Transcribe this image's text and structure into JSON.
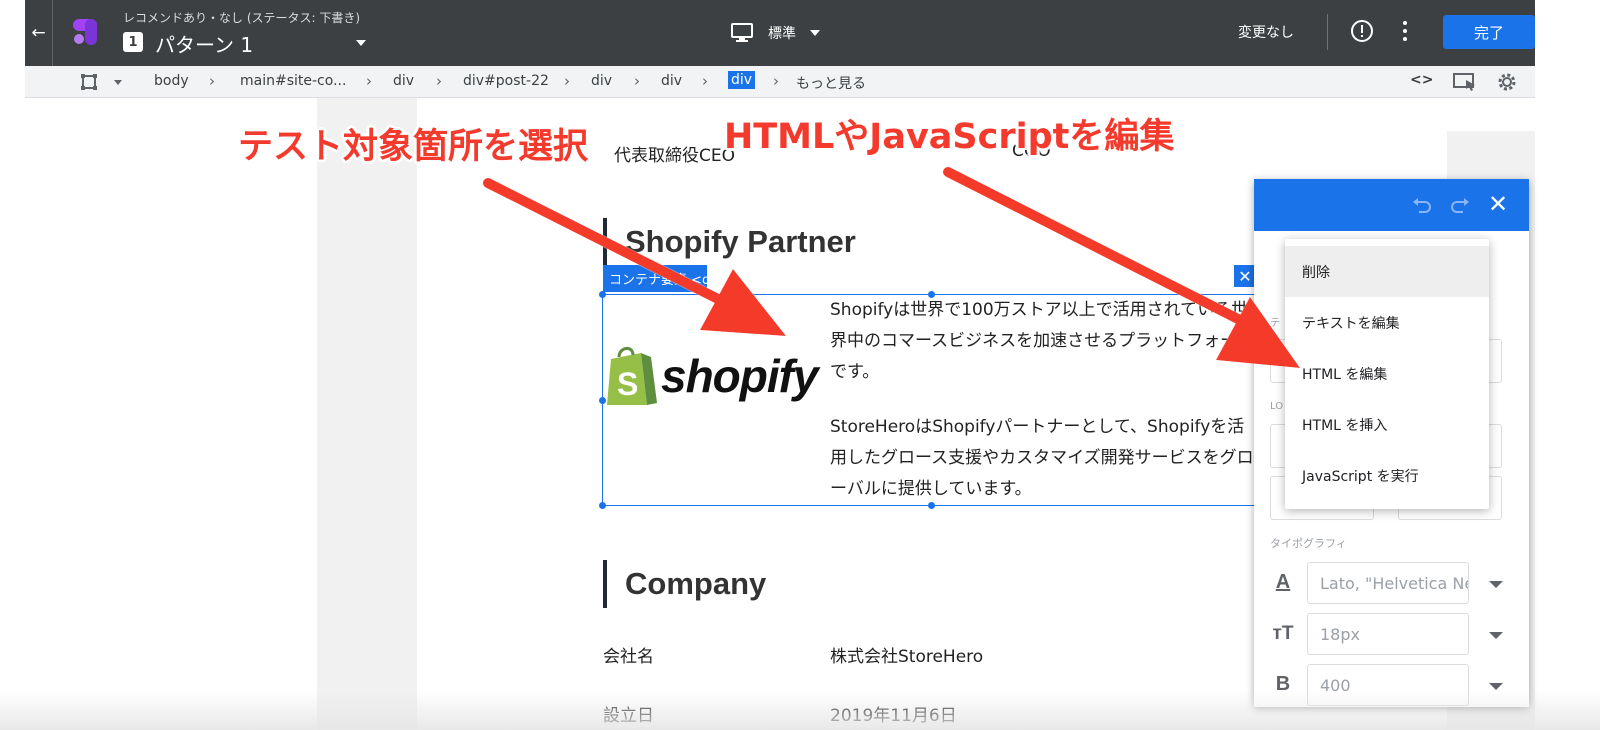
{
  "topbar": {
    "subtitle": "レコメンドあり・なし (ステータス: 下書き)",
    "variant_number": "1",
    "variant_name": "パターン 1",
    "device_label": "標準",
    "status": "変更なし",
    "done_label": "完了",
    "icons": {
      "back": "arrow-left-icon",
      "logo": "optimize-logo",
      "device": "desktop-monitor-icon",
      "info": "exclamation-circle-icon",
      "more": "more-vert-icon"
    }
  },
  "breadcrumb": {
    "items": [
      "body",
      "main#site-co...",
      "div",
      "div#post-22",
      "div",
      "div",
      "div",
      "もっと見る"
    ],
    "active_index": 6,
    "code_label": "<>",
    "icons": {
      "select_tool": "element-select-icon",
      "separator": "chevron-right-icon",
      "cursor": "cursor-select-icon",
      "settings": "gear-icon"
    }
  },
  "page": {
    "top_text_1": "代表取締役CEO",
    "top_text_2": "COO",
    "partner_title": "Shopify Partner",
    "selection_label": "コンテナ要素 <div>",
    "logo_text": "shopify",
    "desc_1": "Shopifyは世界で100万ストア以上で活用されている世界中のコマースビジネスを加速させるプラットフォームです。",
    "desc_2": "StoreHeroはShopifyパートナーとして、Shopifyを活用したグロース支援やカスタマイズ開発サービスをグローバルに提供しています。",
    "company_title": "Company",
    "company_rows": [
      {
        "label": "会社名",
        "value": "株式会社StoreHero"
      },
      {
        "label": "設立日",
        "value": "2019年11月6日"
      }
    ]
  },
  "annotations": {
    "left": "テスト対象箇所を選択",
    "right": "HTMLやJavaScriptを編集",
    "color": "#f43a2c"
  },
  "panel": {
    "close_label": "✕",
    "ghost_labels": [
      "テ",
      "LO"
    ],
    "typography_label": "タイポグラフィ",
    "font_family": "Lato, \"Helvetica Ne",
    "font_size": "18px",
    "font_weight": "400",
    "typo_icons": [
      "A",
      "тT",
      "B"
    ],
    "icons": {
      "undo": "undo-icon",
      "redo": "redo-icon",
      "close": "close-icon"
    },
    "accent_color": "#1a73e8"
  },
  "context_menu": {
    "items": [
      "削除",
      "テキストを編集",
      "HTML を編集",
      "HTML を挿入",
      "JavaScript を実行"
    ],
    "hover_index": 0
  }
}
